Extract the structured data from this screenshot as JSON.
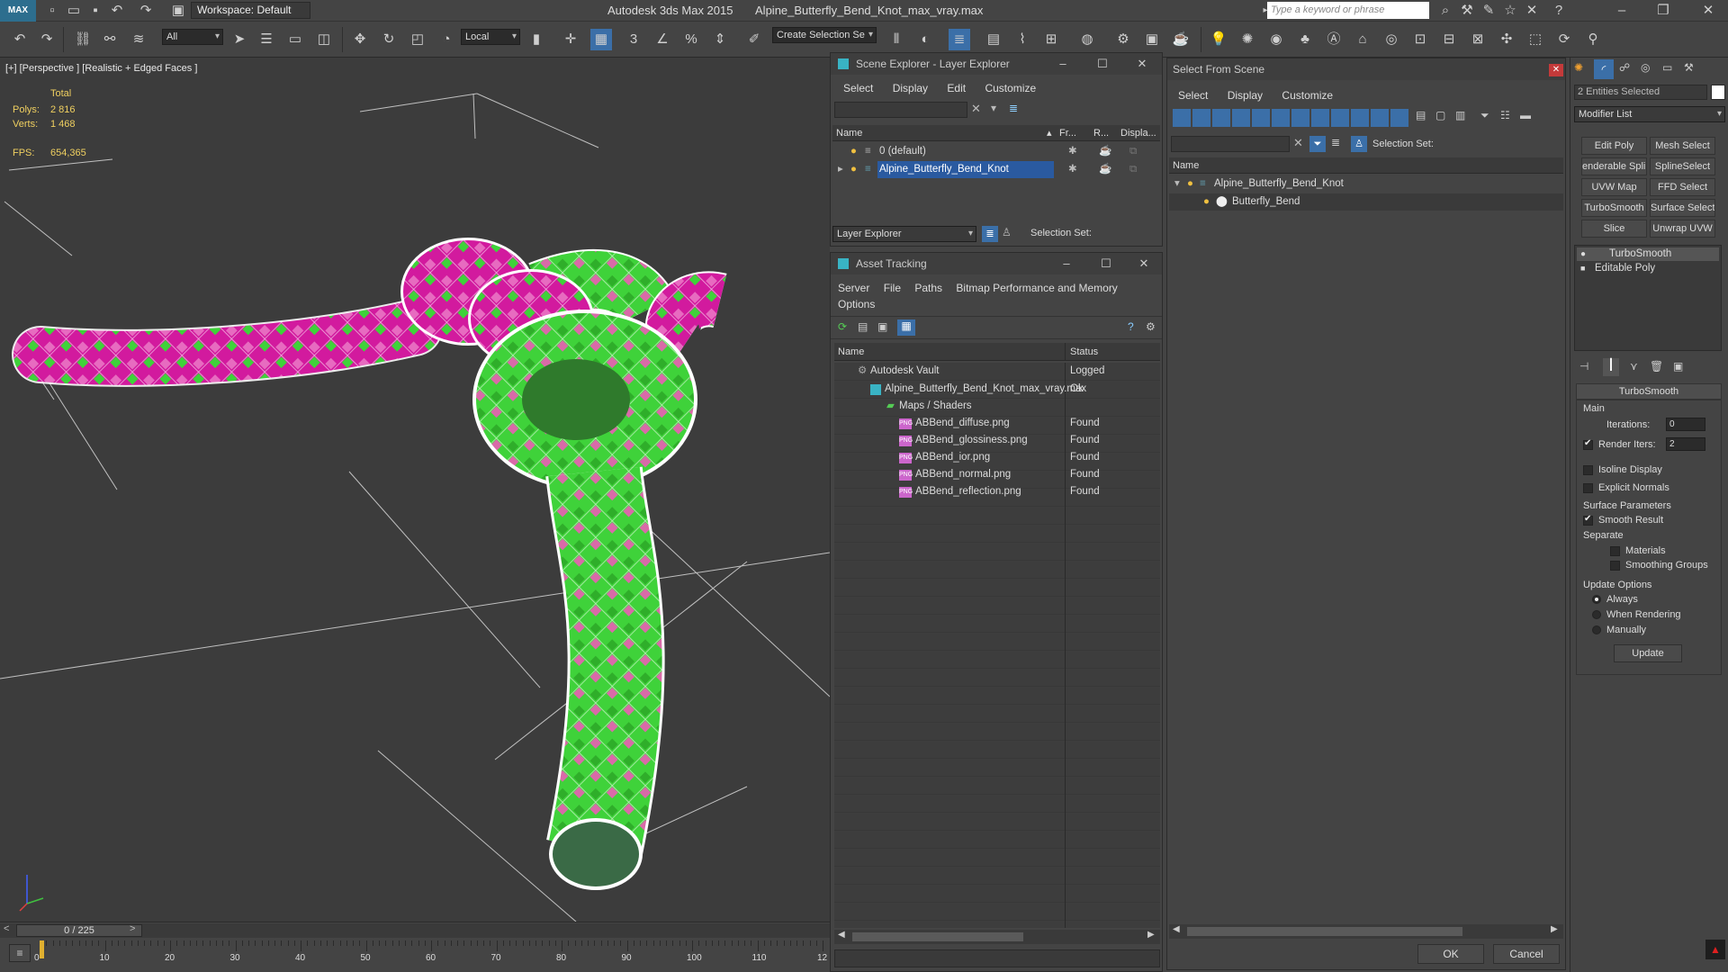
{
  "app": {
    "title_app": "Autodesk 3ds Max  2015",
    "title_file": "Alpine_Butterfly_Bend_Knot_max_vray.max",
    "workspace": "Workspace: Default",
    "search_placeholder": "Type a keyword or phrase"
  },
  "toolbar": {
    "filter": "All",
    "coord": "Local",
    "selection_set": "Create Selection Se"
  },
  "viewport": {
    "label": "[+] [Perspective ] [Realistic + Edged Faces ]",
    "stats_total": "Total",
    "stats_polys_label": "Polys:",
    "stats_polys": "2 816",
    "stats_verts_label": "Verts:",
    "stats_verts": "1 468",
    "stats_fps_label": "FPS:",
    "stats_fps": "654,365"
  },
  "timeline": {
    "frame": "0 / 225",
    "ticks": [
      "0",
      "10",
      "20",
      "30",
      "40",
      "50",
      "60",
      "70",
      "80",
      "90",
      "100",
      "110",
      "12"
    ],
    "frame_progress": 0
  },
  "scene_explorer": {
    "title": "Scene Explorer - Layer Explorer",
    "menu": [
      "Select",
      "Display",
      "Edit",
      "Customize"
    ],
    "col_name": "Name",
    "col_fr": "Fr...",
    "col_r": "R...",
    "col_disp": "Displa...",
    "rows": [
      "0 (default)",
      "Alpine_Butterfly_Bend_Knot"
    ],
    "footer_combo": "Layer Explorer",
    "footer_sel": "Selection Set:"
  },
  "asset_tracking": {
    "title": "Asset Tracking",
    "menu": [
      "Server",
      "File",
      "Paths",
      "Bitmap Performance and Memory"
    ],
    "menu2": "Options",
    "col_name": "Name",
    "col_status": "Status",
    "rows": [
      {
        "name": "Autodesk Vault",
        "status": "Logged"
      },
      {
        "name": "Alpine_Butterfly_Bend_Knot_max_vray.max",
        "status": "Ok"
      },
      {
        "name": "Maps / Shaders",
        "status": ""
      },
      {
        "name": "ABBend_diffuse.png",
        "status": "Found"
      },
      {
        "name": "ABBend_glossiness.png",
        "status": "Found"
      },
      {
        "name": "ABBend_ior.png",
        "status": "Found"
      },
      {
        "name": "ABBend_normal.png",
        "status": "Found"
      },
      {
        "name": "ABBend_reflection.png",
        "status": "Found"
      }
    ]
  },
  "select_from_scene": {
    "title": "Select From Scene",
    "menu": [
      "Select",
      "Display",
      "Customize"
    ],
    "selection_set": "Selection Set:",
    "col_name": "Name",
    "rows": [
      "Alpine_Butterfly_Bend_Knot",
      "Butterfly_Bend"
    ],
    "ok": "OK",
    "cancel": "Cancel"
  },
  "command_panel": {
    "entities": "2 Entities Selected",
    "modifier_list": "Modifier List",
    "buttons": [
      "Edit Poly",
      "Mesh Select",
      "enderable Splin",
      "SplineSelect",
      "UVW Map",
      "FFD Select",
      "TurboSmooth",
      "Surface Select",
      "Slice",
      "Unwrap UVW"
    ],
    "stack": [
      "TurboSmooth",
      "Editable Poly"
    ],
    "rollout": "TurboSmooth",
    "main": "Main",
    "iterations_label": "Iterations:",
    "iterations": "0",
    "render_iters_label": "Render Iters:",
    "render_iters": "2",
    "isoline": "Isoline Display",
    "explicit": "Explicit Normals",
    "surface_params": "Surface Parameters",
    "smooth_result": "Smooth Result",
    "separate": "Separate",
    "materials": "Materials",
    "smoothing_groups": "Smoothing Groups",
    "update_options": "Update Options",
    "always": "Always",
    "when_rendering": "When Rendering",
    "manually": "Manually",
    "update": "Update"
  },
  "colors": {
    "rope_pink": "#d21a9e",
    "rope_green": "#3fd23a",
    "selected": "#2a5aa0",
    "stats": "#f0d060"
  }
}
